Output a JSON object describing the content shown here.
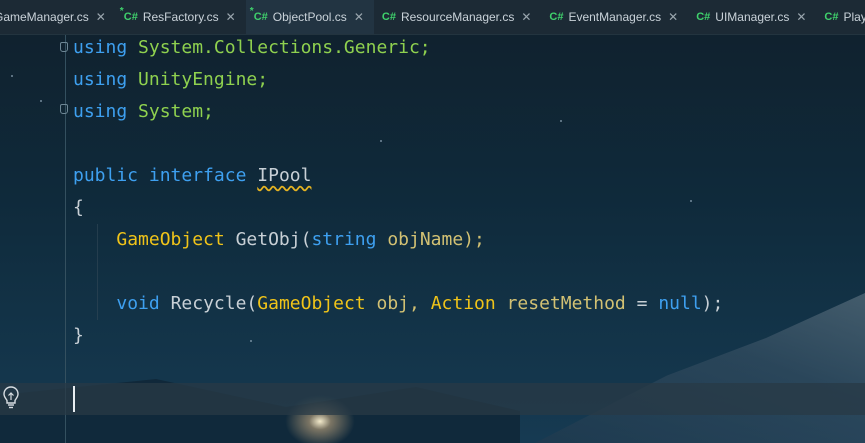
{
  "tabs": [
    {
      "name": "GameManager.cs",
      "icon": "none",
      "modified": false
    },
    {
      "name": "ResFactory.cs",
      "icon": "csharp",
      "modified": true
    },
    {
      "name": "ObjectPool.cs",
      "icon": "csharp",
      "modified": true,
      "active": true
    },
    {
      "name": "ResourceManager.cs",
      "icon": "csharp",
      "modified": false
    },
    {
      "name": "EventManager.cs",
      "icon": "csharp",
      "modified": false
    },
    {
      "name": "UIManager.cs",
      "icon": "csharp",
      "modified": false
    },
    {
      "name": "PlayerManger.",
      "icon": "csharp",
      "modified": false
    }
  ],
  "tab_labels": {
    "cs": "C#",
    "mod": "*",
    "close": "✕"
  },
  "code": {
    "l1": [
      "using",
      "System.Collections.Generic;"
    ],
    "l2": [
      "using",
      "UnityEngine;"
    ],
    "l3": [
      "using",
      "System;"
    ],
    "l4": [
      "public",
      "interface",
      "IPool"
    ],
    "l5": [
      "{"
    ],
    "l6": [
      "GameObject",
      "GetObj(",
      "string",
      "objName);"
    ],
    "l7": [
      "void",
      "Recycle(",
      "GameObject",
      "obj,",
      "Action",
      "resetMethod",
      "=",
      "null",
      ");"
    ],
    "l8": [
      "}"
    ]
  },
  "colors": {
    "keyword": "#3ea0f0",
    "namespace": "#8fd14f",
    "type": "#f0c419",
    "identifier": "#d2c173",
    "csharp_icon": "#3fd16c"
  }
}
